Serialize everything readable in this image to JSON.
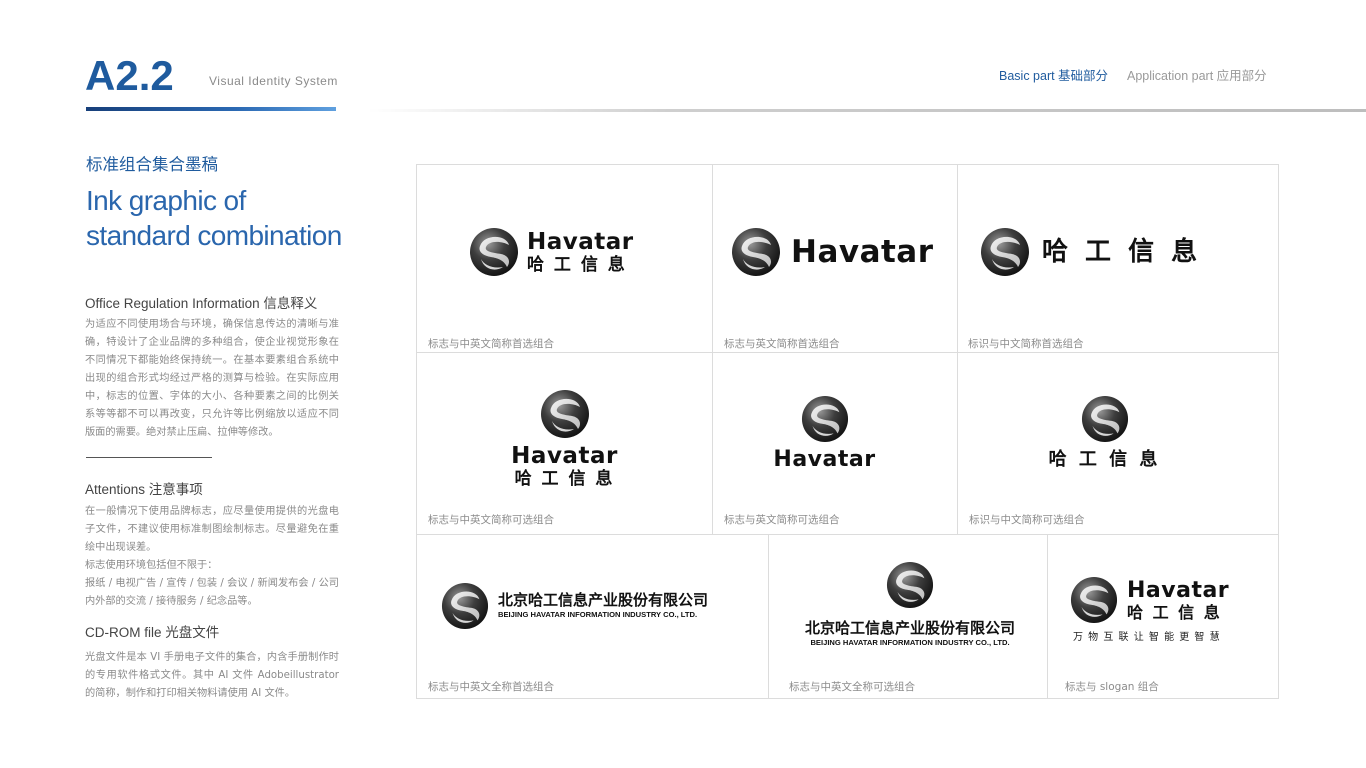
{
  "header": {
    "code": "A2.2",
    "system_label": "Visual Identity System",
    "nav_basic": "Basic part  基础部分",
    "nav_application": "Application part  应用部分"
  },
  "left": {
    "title_cn": "标准组合集合墨稿",
    "title_en": "Ink graphic of standard combination",
    "info_heading": "Office Regulation Information 信息释义",
    "info_text": "为适应不同使用场合与环境，确保信息传达的清晰与准确，特设计了企业品牌的多种组合，使企业视觉形象在不同情况下都能始终保持统一。在基本要素组合系统中出现的组合形式均经过严格的测算与检验。在实际应用中，标志的位置、字体的大小、各种要素之间的比例关系等等都不可以再改变，只允许等比例缩放以适应不同版面的需要。绝对禁止压扁、拉伸等修改。",
    "attn_heading": "Attentions 注意事项",
    "attn_text_1": "在一般情况下使用品牌标志，应尽量使用提供的光盘电子文件，不建议使用标准制图绘制标志。尽量避免在重绘中出现误差。",
    "attn_text_2": "标志使用环境包括但不限于：",
    "attn_text_3": "报纸 / 电视广告 / 宣传 / 包装 / 会议 / 新闻发布会 / 公司内外部的交流 / 接待服务 / 纪念品等。",
    "cd_heading": "CD-ROM file 光盘文件",
    "cd_text": "光盘文件是本 VI 手册电子文件的集合，内含手册制作时的专用软件格式文件。其中 AI 文件 Adobeillustrator 的简称，制作和打印相关物料请使用 AI 文件。"
  },
  "brand": {
    "name_en": "Havatar",
    "name_cn": "哈 工 信 息",
    "company_cn": "北京哈工信息产业股份有限公司",
    "company_en": "BEIJING HAVATAR  INFORMATION INDUSTRY CO., LTD.",
    "slogan": "万 物 互 联    让 智 能 更 智 慧"
  },
  "captions": {
    "c1": "标志与中英文简称首选组合",
    "c2": "标志与英文简称首选组合",
    "c3": "标识与中文简称首选组合",
    "c4": "标志与中英文简称可选组合",
    "c5": "标志与英文简称可选组合",
    "c6": "标识与中文简称可选组合",
    "c7": "标志与中英文全称首选组合",
    "c8": "标志与中英文全称可选组合",
    "c9": "标志与 slogan 组合"
  },
  "colors": {
    "accent_blue": "#1f5b9e",
    "logo_black": "#111111",
    "grid_line": "#dcdcdc"
  },
  "icons": {
    "brand_mark": "havatar-sphere-logo-icon"
  }
}
